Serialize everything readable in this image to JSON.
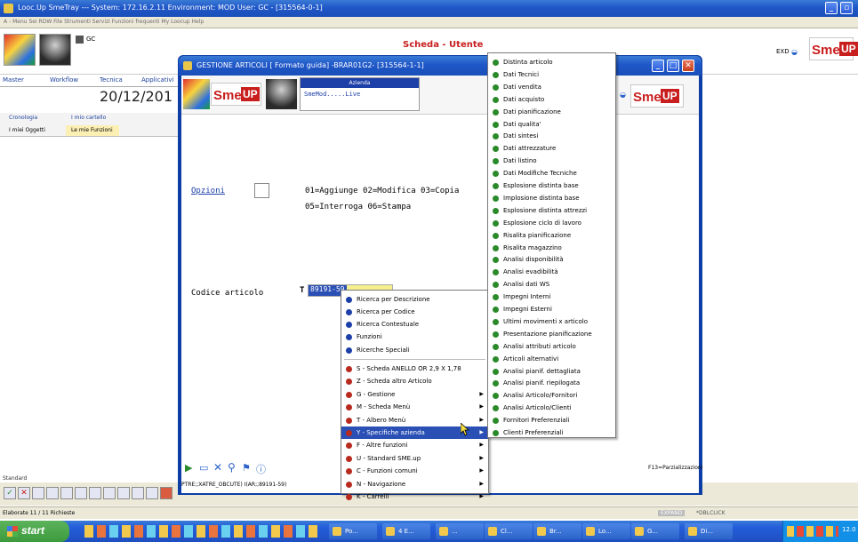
{
  "outer": {
    "title": "Looc.Up SmeTray --- System: 172.16.2.11 Environment: MOD User: GC - [315564-0-1]",
    "menubar": "A - Menu Sei RDW  File  Strumenti  Servizi  Funzioni frequenti  My Loocup  Help",
    "user_code": "GC",
    "window_title": "Scheda - Utente",
    "exd_label": "EXD",
    "tabs": [
      "Master",
      "Workflow",
      "Tecnica",
      "Applicativi"
    ],
    "date": "20/12/201",
    "subtabs": [
      "Cronologia",
      "I miei Oggetti"
    ],
    "subtabs2": [
      "I mio cartello",
      "Le mie Funzioni"
    ],
    "standard_label": "Standard",
    "status_left": "Elaborate 11 / 11 Richieste",
    "status_right1": "EXPAND",
    "status_right2": "*DBLCLICK",
    "colors": {
      "accent": "#1f57c9",
      "brand_red": "#c81e1e"
    }
  },
  "dialog": {
    "title": "GESTIONE ARTICOLI [ Formato guida] -BRAR01G2- [315564-1-1]",
    "azienda_label": "Azienda",
    "azienda_value": "SmeMod.....Live",
    "opzioni_label": "Opzioni",
    "opzioni_text1": "01=Aggiunge 02=Modifica 03=Copia",
    "opzioni_text2": "05=Interroga 06=Stampa",
    "codice_label": "Codice articolo",
    "codice_marker": "T",
    "codice_value": "89191-59",
    "f13_label": "F13=Parzializzazioni",
    "cmd_text": "PTRE;;XATRE_OBCUTE) I(AR;;89191-59)"
  },
  "context_menu": {
    "items": [
      {
        "label": "Ricerca per Descrizione",
        "color": "#1c3fa8",
        "arrow": false
      },
      {
        "label": "Ricerca per Codice",
        "color": "#1c3fa8",
        "arrow": false
      },
      {
        "label": "Ricerca Contestuale",
        "color": "#1c3fa8",
        "arrow": false
      },
      {
        "label": "Funzioni",
        "color": "#1c3fa8",
        "arrow": false
      },
      {
        "label": "Ricerche Speciali",
        "color": "#1c3fa8",
        "arrow": false
      },
      {
        "label": "S - Scheda ANELLO OR 2,9 X 1,78",
        "color": "#b8291e",
        "arrow": false
      },
      {
        "label": "Z - Scheda altro Articolo",
        "color": "#b8291e",
        "arrow": false
      },
      {
        "label": "G - Gestione",
        "color": "#b8291e",
        "arrow": true
      },
      {
        "label": "M - Scheda Menù",
        "color": "#b8291e",
        "arrow": true
      },
      {
        "label": "T - Albero Menù",
        "color": "#b8291e",
        "arrow": true
      },
      {
        "label": "Y - Specifiche azienda",
        "color": "#b8291e",
        "arrow": true,
        "selected": true
      },
      {
        "label": "F - Altre funzioni",
        "color": "#b8291e",
        "arrow": true
      },
      {
        "label": "U - Standard SME.up",
        "color": "#b8291e",
        "arrow": true
      },
      {
        "label": "C - Funzioni comuni",
        "color": "#b8291e",
        "arrow": true
      },
      {
        "label": "N - Navigazione",
        "color": "#b8291e",
        "arrow": true
      },
      {
        "label": "K - Carrelli",
        "color": "#b8291e",
        "arrow": true
      }
    ]
  },
  "submenu": {
    "items": [
      "Distinta articolo",
      "Dati Tecnici",
      "Dati vendita",
      "Dati acquisto",
      "Dati pianificazione",
      "Dati qualita'",
      "Dati sintesi",
      "Dati attrezzature",
      "Dati listino",
      "Dati Modifiche Tecniche",
      "Esplosione distinta base",
      "Implosione distinta base",
      "Esplosione distinta attrezzi",
      "Esplosione ciclo di lavoro",
      "Risalita pianificazione",
      "Risalita magazzino",
      "Analisi disponibilità",
      "Analisi evadibilità",
      "Analisi dati WS",
      "Impegni Interni",
      "Impegni Esterni",
      "Ultimi movimenti x articolo",
      "Presentazione pianificazione",
      "Analisi attributi articolo",
      "Articoli alternativi",
      "Analisi pianif. dettagliata",
      "Analisi pianif. riepilogata",
      "Analisi Articolo/Fornitori",
      "Analisi Articolo/Clienti",
      "Fornitori Preferenziali",
      "Clienti Preferenziali"
    ]
  },
  "taskbar": {
    "start_label": "start",
    "buttons": [
      "Po...",
      "4 E... ",
      "...",
      "Cl...",
      "Br...",
      "Lo...",
      "G...",
      "Di..."
    ],
    "clock": "12.0"
  }
}
